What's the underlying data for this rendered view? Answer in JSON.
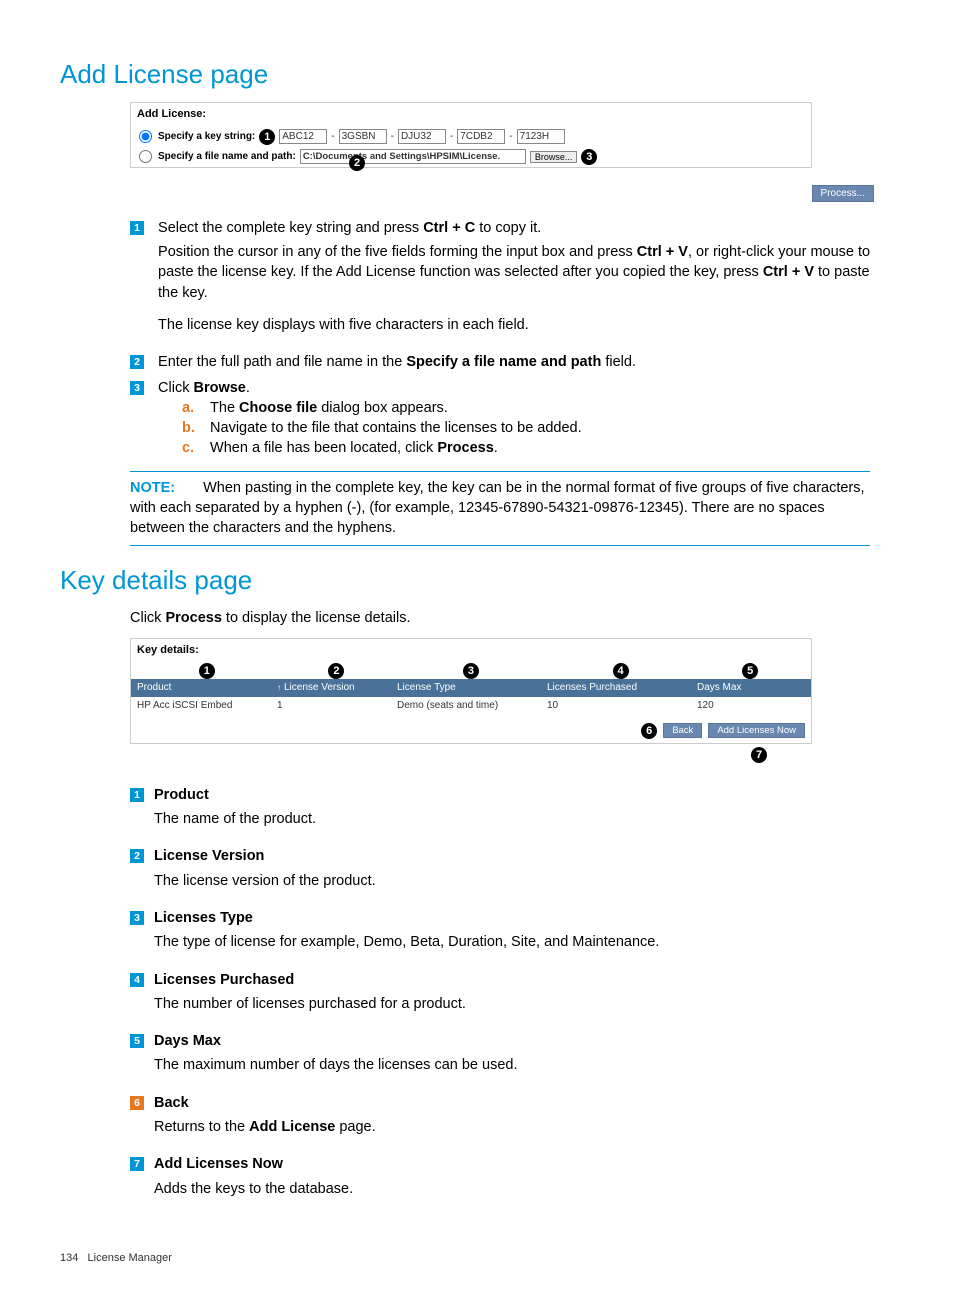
{
  "heading1": "Add License page",
  "fig1": {
    "title": "Add License:",
    "opt1": "Specify a key string:",
    "opt2": "Specify a file name and path:",
    "keys": [
      "ABC12",
      "3GSBN",
      "DJU32",
      "7CDB2",
      "7123H"
    ],
    "path": "C:\\Documents and Settings\\HPSIM\\License.",
    "browse": "Browse...",
    "process": "Process..."
  },
  "steps": [
    {
      "num": "1",
      "lead": "Select the complete key string and press ",
      "bold1": "Ctrl + C",
      "trail1": " to copy it.",
      "p2a": "Position the cursor in any of the five fields forming the input box and press ",
      "p2b": "Ctrl + V",
      "p2c": ", or right-click your mouse to paste the license key. If the Add License function was selected after you copied the key, press ",
      "p2d": "Ctrl + V",
      "p2e": " to paste the key.",
      "p3": "The license key displays with five characters in each field."
    },
    {
      "num": "2",
      "lead": "Enter the full path and file name in the ",
      "bold1": "Specify a file name and path",
      "trail1": " field."
    },
    {
      "num": "3",
      "lead": "Click ",
      "bold1": "Browse",
      "trail1": ".",
      "subs": [
        {
          "l": "a.",
          "t1": "The ",
          "b": "Choose file",
          "t2": " dialog box appears."
        },
        {
          "l": "b.",
          "t1": "Navigate to the file that contains the licenses to be added.",
          "b": "",
          "t2": ""
        },
        {
          "l": "c.",
          "t1": "When a file has been located, click ",
          "b": "Process",
          "t2": "."
        }
      ]
    }
  ],
  "note": {
    "label": "NOTE:",
    "text": "When pasting in the complete key, the key can be in the normal format of five groups of five characters, with each separated by a hyphen (-), (for example, 12345-67890-54321-09876-12345). There are no spaces between the characters and the hyphens."
  },
  "heading2": "Key details page",
  "intro2a": "Click ",
  "intro2b": "Process",
  "intro2c": " to display the license details.",
  "fig2": {
    "title": "Key details:",
    "headers": [
      "Product",
      "License Version",
      "License Type",
      "Licenses Purchased",
      "Days Max"
    ],
    "row": [
      "HP Acc iSCSI Embed",
      "1",
      "Demo (seats and time)",
      "10",
      "120"
    ],
    "back": "Back",
    "add": "Add Licenses Now"
  },
  "defs": [
    {
      "num": "1",
      "title": "Product",
      "desc": "The name of the product."
    },
    {
      "num": "2",
      "title": "License Version",
      "desc": "The license version of the product."
    },
    {
      "num": "3",
      "title": "Licenses Type",
      "desc": "The type of license for example, Demo, Beta, Duration, Site, and Maintenance."
    },
    {
      "num": "4",
      "title": "Licenses Purchased",
      "desc": "The number of licenses purchased for a product."
    },
    {
      "num": "5",
      "title": "Days Max",
      "desc": "The maximum number of days the licenses can be used."
    },
    {
      "num": "6",
      "title": "Back",
      "descA": "Returns to the ",
      "descB": "Add License",
      "descC": "  page."
    },
    {
      "num": "7",
      "title": "Add Licenses Now",
      "desc": "Adds the keys to the database."
    }
  ],
  "footer": {
    "page": "134",
    "section": "License Manager"
  }
}
